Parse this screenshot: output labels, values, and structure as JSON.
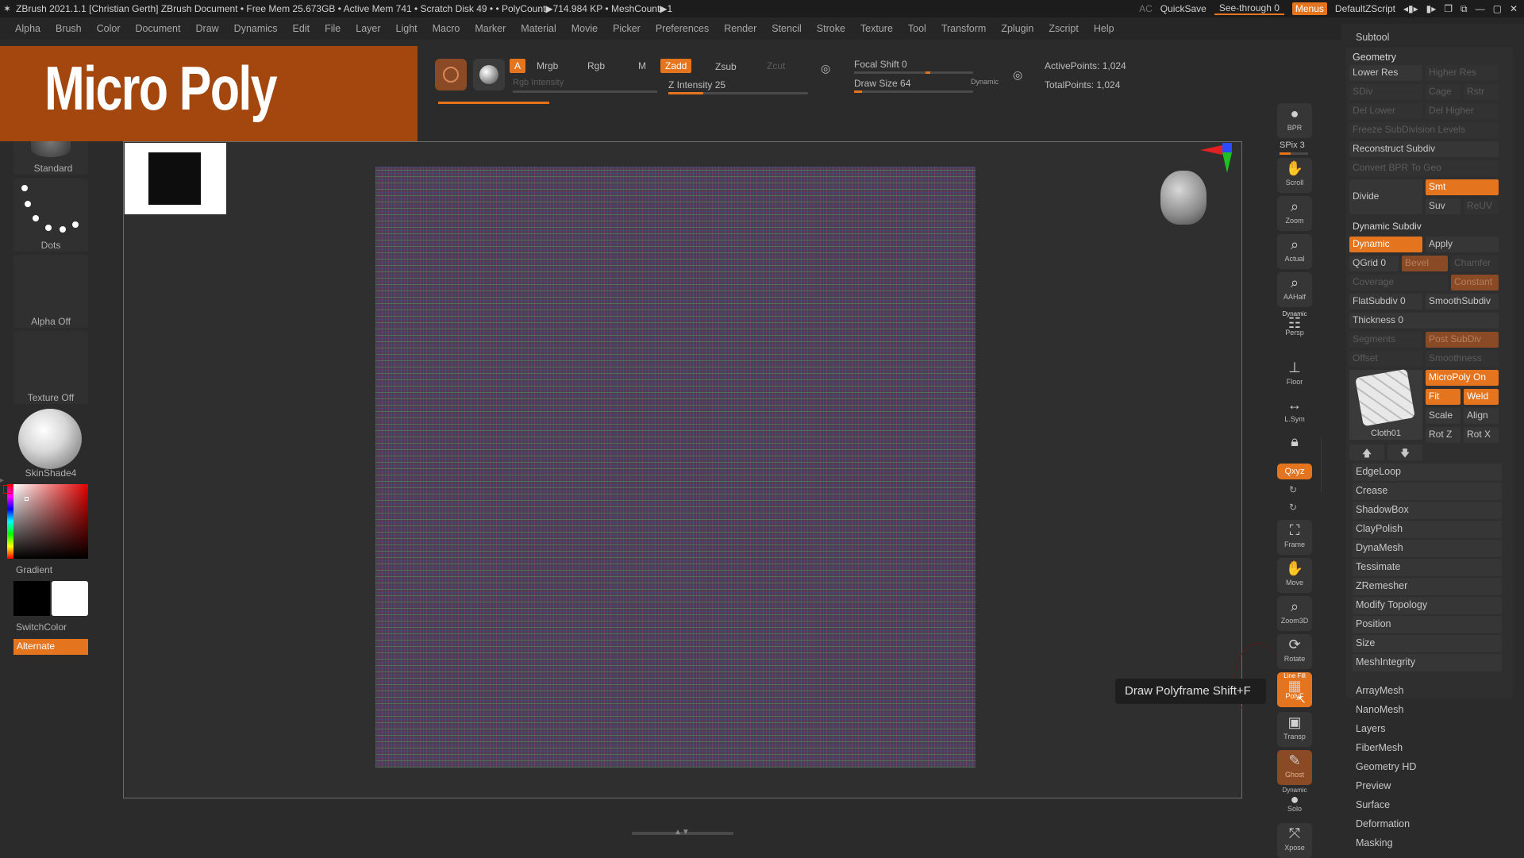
{
  "titlebar": {
    "text": "ZBrush 2021.1.1 [Christian Gerth]   ZBrush Document     • Free Mem 25.673GB • Active Mem 741 • Scratch Disk 49 •  • PolyCount▶714.984 KP  • MeshCount▶1",
    "ac": "AC",
    "quicksave": "QuickSave",
    "seethrough": "See-through  0",
    "menus": "Menus",
    "script": "DefaultZScript"
  },
  "menubar": [
    "Alpha",
    "Brush",
    "Color",
    "Document",
    "Draw",
    "Dynamics",
    "Edit",
    "File",
    "Layer",
    "Light",
    "Macro",
    "Marker",
    "Material",
    "Movie",
    "Picker",
    "Preferences",
    "Render",
    "Stencil",
    "Stroke",
    "Texture",
    "Tool",
    "Transform",
    "Zplugin",
    "Zscript",
    "Help"
  ],
  "banner": {
    "title": "Micro Poly"
  },
  "shelf": {
    "a": "A",
    "mrgb": "Mrgb",
    "rgb": "Rgb",
    "m": "M",
    "zadd": "Zadd",
    "zsub": "Zsub",
    "zcut": "Zcut",
    "rgb_intensity": "Rgb Intensity",
    "z_intensity": "Z Intensity 25",
    "focal_shift": "Focal Shift 0",
    "draw_size": "Draw Size 64",
    "dynamic": "Dynamic",
    "active_points": "ActivePoints: 1,024",
    "total_points": "TotalPoints: 1,024",
    "z_intensity_value": 25,
    "draw_size_value": 64
  },
  "left_tray": {
    "brush": "Standard",
    "stroke": "Dots",
    "alpha": "Alpha Off",
    "texture": "Texture Off",
    "material": "SkinShade4",
    "gradient": "Gradient",
    "switchcolor": "SwitchColor",
    "alternate": "Alternate"
  },
  "right_tools": {
    "bpr": "BPR",
    "spix": "SPix 3",
    "scroll": "Scroll",
    "zoom": "Zoom",
    "actual": "Actual",
    "aahalf": "AAHalf",
    "persp": "Persp",
    "dynamic": "Dynamic",
    "floor": "Floor",
    "lsym": "L.Sym",
    "xyz": "Qxyz",
    "frame": "Frame",
    "move": "Move",
    "zoom3d": "Zoom3D",
    "rotate": "Rotate",
    "polyf": "PolyF",
    "linefill": "Line Fill",
    "transp": "Transp",
    "ghost": "Ghost",
    "solo": "Solo",
    "xpose": "Xpose"
  },
  "tooltip": "Draw Polyframe  Shift+F",
  "palette": {
    "subtool": "Subtool",
    "geometry": "Geometry",
    "lower_res": "Lower Res",
    "higher_res": "Higher Res",
    "sdiv": "SDiv",
    "cage": "Cage",
    "rstr": "Rstr",
    "del_lower": "Del Lower",
    "del_higher": "Del Higher",
    "freeze": "Freeze SubDivision Levels",
    "reconstruct": "Reconstruct Subdiv",
    "convert_bpr": "Convert BPR To Geo",
    "divide": "Divide",
    "smt": "Smt",
    "suv": "Suv",
    "reuv": "ReUV",
    "dynamic_subdiv": "Dynamic Subdiv",
    "dynamic": "Dynamic",
    "apply": "Apply",
    "qgrid": "QGrid 0",
    "bevel": "Bevel",
    "chamfer": "Chamfer",
    "coverage": "Coverage",
    "constant": "Constant",
    "flatsubdiv": "FlatSubdiv 0",
    "smoothsubdiv": "SmoothSubdiv",
    "thickness": "Thickness 0",
    "segments": "Segments",
    "post_subdiv": "Post SubDiv",
    "offset": "Offset",
    "smoothness": "Smoothness",
    "micropoly_on": "MicroPoly On",
    "fit": "Fit",
    "weld": "Weld",
    "scale": "Scale",
    "align": "Align",
    "rotz": "Rot Z",
    "rotx": "Rot X",
    "cloth": "Cloth01",
    "sections": [
      "EdgeLoop",
      "Crease",
      "ShadowBox",
      "ClayPolish",
      "DynaMesh",
      "Tessimate",
      "ZRemesher",
      "Modify Topology",
      "Position",
      "Size",
      "MeshIntegrity"
    ],
    "subpalettes": [
      "ArrayMesh",
      "NanoMesh",
      "Layers",
      "FiberMesh",
      "Geometry HD",
      "Preview",
      "Surface",
      "Deformation",
      "Masking"
    ]
  }
}
